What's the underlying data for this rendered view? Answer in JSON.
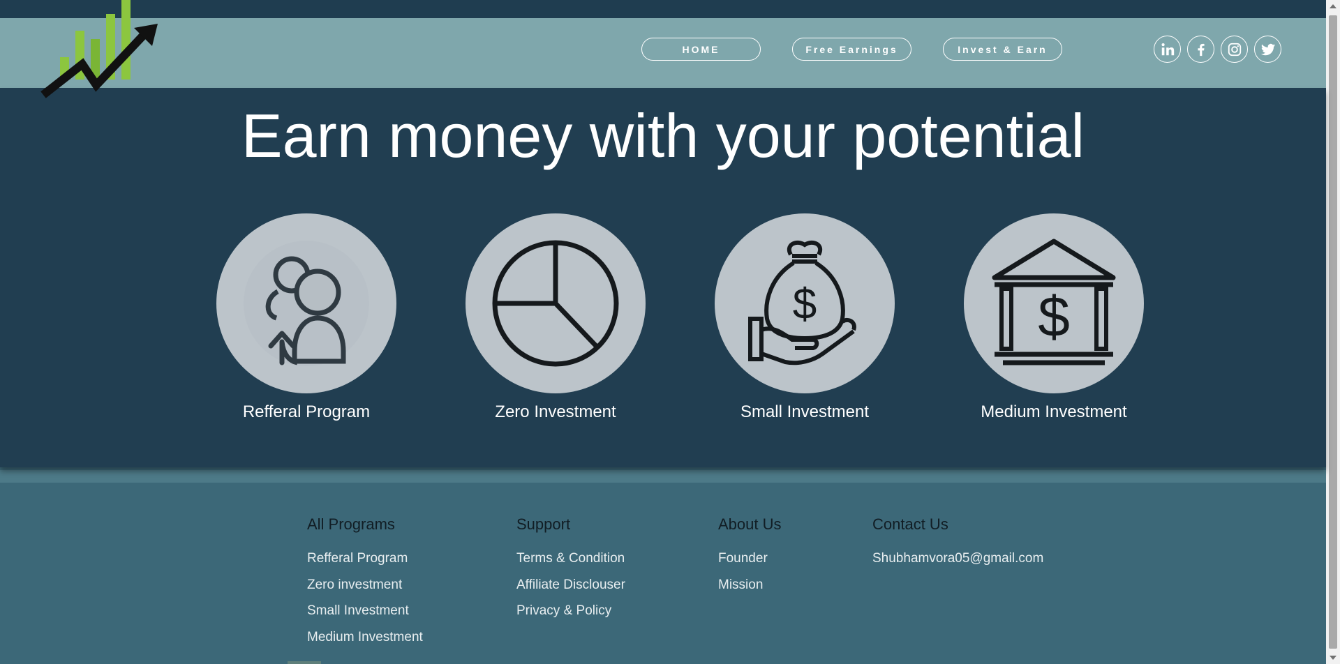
{
  "nav": {
    "items": [
      "HOME",
      "Free Earnings",
      "Invest & Earn"
    ],
    "social_icons": [
      "linkedin-icon",
      "facebook-icon",
      "instagram-icon",
      "twitter-icon"
    ]
  },
  "hero": {
    "title": "Earn money with your potential",
    "programs": [
      {
        "label": "Refferal Program",
        "icon": "referral-users-icon"
      },
      {
        "label": "Zero Investment",
        "icon": "pie-chart-icon"
      },
      {
        "label": "Small Investment",
        "icon": "money-bag-hand-icon"
      },
      {
        "label": "Medium Investment",
        "icon": "bank-dollar-icon"
      }
    ]
  },
  "footer": {
    "columns": [
      {
        "heading": "All Programs",
        "links": [
          "Refferal Program",
          "Zero investment",
          "Small Investment",
          "Medium Investment"
        ]
      },
      {
        "heading": "Support",
        "links": [
          "Terms & Condition",
          "Affiliate Disclouser",
          "Privacy & Policy"
        ]
      },
      {
        "heading": "About Us",
        "links": [
          "Founder",
          "Mission"
        ]
      },
      {
        "heading": "Contact Us",
        "links": [
          "Shubhamvora05@gmail.com"
        ]
      }
    ]
  },
  "colors": {
    "header_bg": "#7fa7ac",
    "hero_bg": "#213e51",
    "footer_bg": "#3c6878",
    "icon_circle": "#bcc4ca",
    "logo_green": "#8cc63f"
  }
}
